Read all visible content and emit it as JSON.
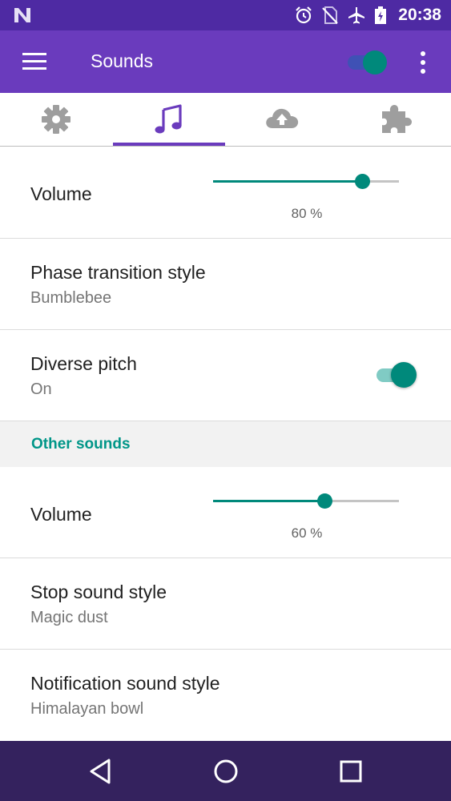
{
  "status_bar": {
    "time": "20:38",
    "icons": [
      "notification-n-icon",
      "alarm-icon",
      "no-sim-icon",
      "airplane-mode-icon",
      "battery-charging-icon"
    ]
  },
  "app_bar": {
    "title": "Sounds",
    "master_switch_on": true,
    "icons": [
      "menu-icon",
      "more-vert-icon"
    ]
  },
  "tabs": [
    {
      "icon": "gear-icon",
      "selected": false
    },
    {
      "icon": "music-note-icon",
      "selected": true
    },
    {
      "icon": "cloud-upload-icon",
      "selected": false
    },
    {
      "icon": "puzzle-icon",
      "selected": false
    }
  ],
  "settings": {
    "volume": {
      "label": "Volume",
      "value_text": "80 %",
      "value": 80
    },
    "phase_transition": {
      "title": "Phase transition style",
      "value": "Bumblebee"
    },
    "diverse_pitch": {
      "title": "Diverse pitch",
      "value": "On",
      "enabled": true
    }
  },
  "other_sounds": {
    "header": "Other sounds",
    "volume": {
      "label": "Volume",
      "value_text": "60 %",
      "value": 60
    },
    "stop_sound": {
      "title": "Stop sound style",
      "value": "Magic dust"
    },
    "notification_sound": {
      "title": "Notification sound style",
      "value": "Himalayan bowl"
    }
  },
  "colors": {
    "status_bar": "#4e2aa3",
    "app_bar": "#6a3bbd",
    "accent": "#00897b",
    "section_header": "#009688",
    "nav_bar": "#34225e"
  },
  "nav_bar": {
    "icons": [
      "back-icon",
      "home-icon",
      "recents-icon"
    ]
  }
}
